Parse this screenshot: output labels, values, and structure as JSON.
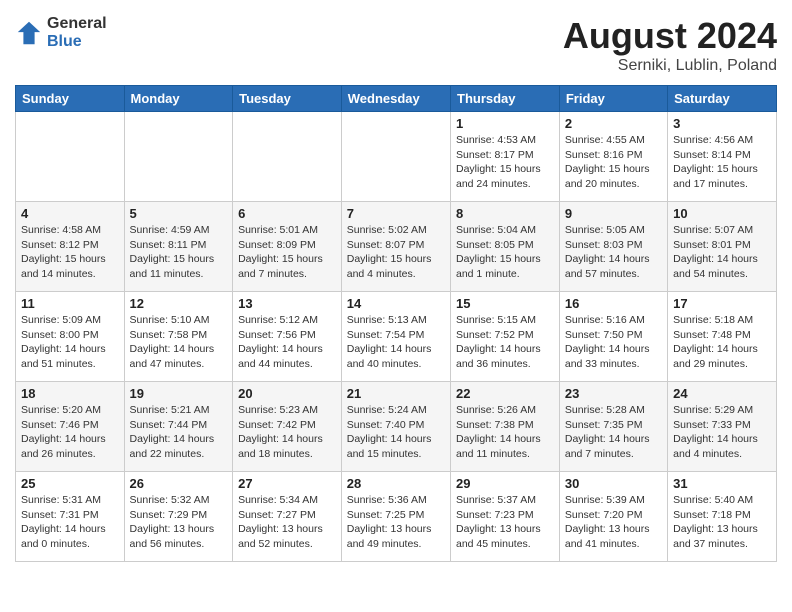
{
  "logo": {
    "general": "General",
    "blue": "Blue"
  },
  "title": "August 2024",
  "location": "Serniki, Lublin, Poland",
  "days_of_week": [
    "Sunday",
    "Monday",
    "Tuesday",
    "Wednesday",
    "Thursday",
    "Friday",
    "Saturday"
  ],
  "weeks": [
    [
      {
        "day": "",
        "info": ""
      },
      {
        "day": "",
        "info": ""
      },
      {
        "day": "",
        "info": ""
      },
      {
        "day": "",
        "info": ""
      },
      {
        "day": "1",
        "info": "Sunrise: 4:53 AM\nSunset: 8:17 PM\nDaylight: 15 hours\nand 24 minutes."
      },
      {
        "day": "2",
        "info": "Sunrise: 4:55 AM\nSunset: 8:16 PM\nDaylight: 15 hours\nand 20 minutes."
      },
      {
        "day": "3",
        "info": "Sunrise: 4:56 AM\nSunset: 8:14 PM\nDaylight: 15 hours\nand 17 minutes."
      }
    ],
    [
      {
        "day": "4",
        "info": "Sunrise: 4:58 AM\nSunset: 8:12 PM\nDaylight: 15 hours\nand 14 minutes."
      },
      {
        "day": "5",
        "info": "Sunrise: 4:59 AM\nSunset: 8:11 PM\nDaylight: 15 hours\nand 11 minutes."
      },
      {
        "day": "6",
        "info": "Sunrise: 5:01 AM\nSunset: 8:09 PM\nDaylight: 15 hours\nand 7 minutes."
      },
      {
        "day": "7",
        "info": "Sunrise: 5:02 AM\nSunset: 8:07 PM\nDaylight: 15 hours\nand 4 minutes."
      },
      {
        "day": "8",
        "info": "Sunrise: 5:04 AM\nSunset: 8:05 PM\nDaylight: 15 hours\nand 1 minute."
      },
      {
        "day": "9",
        "info": "Sunrise: 5:05 AM\nSunset: 8:03 PM\nDaylight: 14 hours\nand 57 minutes."
      },
      {
        "day": "10",
        "info": "Sunrise: 5:07 AM\nSunset: 8:01 PM\nDaylight: 14 hours\nand 54 minutes."
      }
    ],
    [
      {
        "day": "11",
        "info": "Sunrise: 5:09 AM\nSunset: 8:00 PM\nDaylight: 14 hours\nand 51 minutes."
      },
      {
        "day": "12",
        "info": "Sunrise: 5:10 AM\nSunset: 7:58 PM\nDaylight: 14 hours\nand 47 minutes."
      },
      {
        "day": "13",
        "info": "Sunrise: 5:12 AM\nSunset: 7:56 PM\nDaylight: 14 hours\nand 44 minutes."
      },
      {
        "day": "14",
        "info": "Sunrise: 5:13 AM\nSunset: 7:54 PM\nDaylight: 14 hours\nand 40 minutes."
      },
      {
        "day": "15",
        "info": "Sunrise: 5:15 AM\nSunset: 7:52 PM\nDaylight: 14 hours\nand 36 minutes."
      },
      {
        "day": "16",
        "info": "Sunrise: 5:16 AM\nSunset: 7:50 PM\nDaylight: 14 hours\nand 33 minutes."
      },
      {
        "day": "17",
        "info": "Sunrise: 5:18 AM\nSunset: 7:48 PM\nDaylight: 14 hours\nand 29 minutes."
      }
    ],
    [
      {
        "day": "18",
        "info": "Sunrise: 5:20 AM\nSunset: 7:46 PM\nDaylight: 14 hours\nand 26 minutes."
      },
      {
        "day": "19",
        "info": "Sunrise: 5:21 AM\nSunset: 7:44 PM\nDaylight: 14 hours\nand 22 minutes."
      },
      {
        "day": "20",
        "info": "Sunrise: 5:23 AM\nSunset: 7:42 PM\nDaylight: 14 hours\nand 18 minutes."
      },
      {
        "day": "21",
        "info": "Sunrise: 5:24 AM\nSunset: 7:40 PM\nDaylight: 14 hours\nand 15 minutes."
      },
      {
        "day": "22",
        "info": "Sunrise: 5:26 AM\nSunset: 7:38 PM\nDaylight: 14 hours\nand 11 minutes."
      },
      {
        "day": "23",
        "info": "Sunrise: 5:28 AM\nSunset: 7:35 PM\nDaylight: 14 hours\nand 7 minutes."
      },
      {
        "day": "24",
        "info": "Sunrise: 5:29 AM\nSunset: 7:33 PM\nDaylight: 14 hours\nand 4 minutes."
      }
    ],
    [
      {
        "day": "25",
        "info": "Sunrise: 5:31 AM\nSunset: 7:31 PM\nDaylight: 14 hours\nand 0 minutes."
      },
      {
        "day": "26",
        "info": "Sunrise: 5:32 AM\nSunset: 7:29 PM\nDaylight: 13 hours\nand 56 minutes."
      },
      {
        "day": "27",
        "info": "Sunrise: 5:34 AM\nSunset: 7:27 PM\nDaylight: 13 hours\nand 52 minutes."
      },
      {
        "day": "28",
        "info": "Sunrise: 5:36 AM\nSunset: 7:25 PM\nDaylight: 13 hours\nand 49 minutes."
      },
      {
        "day": "29",
        "info": "Sunrise: 5:37 AM\nSunset: 7:23 PM\nDaylight: 13 hours\nand 45 minutes."
      },
      {
        "day": "30",
        "info": "Sunrise: 5:39 AM\nSunset: 7:20 PM\nDaylight: 13 hours\nand 41 minutes."
      },
      {
        "day": "31",
        "info": "Sunrise: 5:40 AM\nSunset: 7:18 PM\nDaylight: 13 hours\nand 37 minutes."
      }
    ]
  ]
}
